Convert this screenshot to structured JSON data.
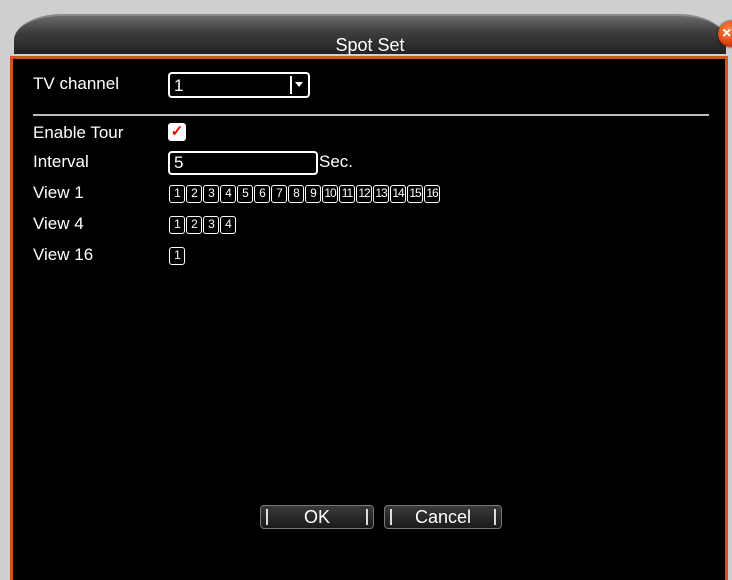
{
  "window": {
    "title": "Spot Set",
    "close_icon": "close-icon",
    "accent": "#c65a1e"
  },
  "form": {
    "tv_channel_label": "TV channel",
    "tv_channel_value": "1",
    "enable_tour_label": "Enable Tour",
    "enable_tour_checked": true,
    "enable_tour_mark": "✓",
    "interval_label": "Interval",
    "interval_value": "5",
    "interval_unit": "Sec.",
    "view1_label": "View 1",
    "view1_channels": [
      "1",
      "2",
      "3",
      "4",
      "5",
      "6",
      "7",
      "8",
      "9",
      "10",
      "11",
      "12",
      "13",
      "14",
      "15",
      "16"
    ],
    "view4_label": "View 4",
    "view4_channels": [
      "1",
      "2",
      "3",
      "4"
    ],
    "view16_label": "View 16",
    "view16_channels": [
      "1"
    ]
  },
  "buttons": {
    "ok_label": "OK",
    "cancel_label": "Cancel"
  }
}
